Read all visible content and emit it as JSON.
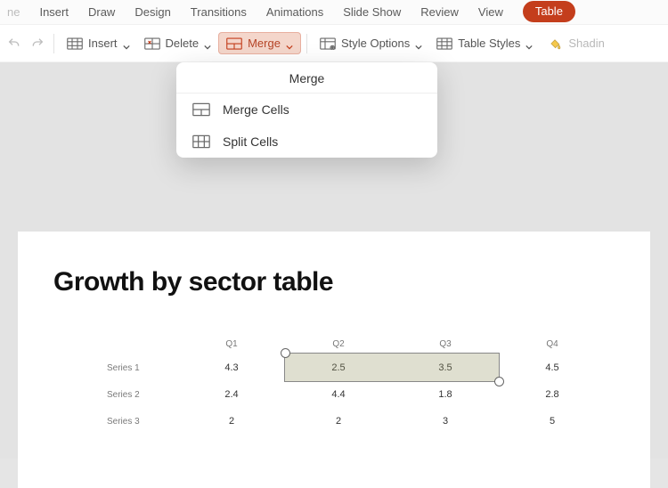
{
  "tabs": {
    "home_cut": "ne",
    "insert": "Insert",
    "draw": "Draw",
    "design": "Design",
    "transitions": "Transitions",
    "animations": "Animations",
    "slideshow": "Slide Show",
    "review": "Review",
    "view": "View",
    "table": "Table",
    "shading_cut": "Shadin"
  },
  "ribbon": {
    "insert": "Insert",
    "delete": "Delete",
    "merge": "Merge",
    "style_options": "Style Options",
    "table_styles": "Table Styles"
  },
  "merge_menu": {
    "title": "Merge",
    "merge_cells": "Merge Cells",
    "split_cells": "Split Cells"
  },
  "slide": {
    "title": "Growth by sector table"
  },
  "chart_data": {
    "type": "table",
    "title": "Growth by sector table",
    "columns": [
      "Q1",
      "Q2",
      "Q3",
      "Q4"
    ],
    "series": [
      {
        "name": "Series 1",
        "values": [
          4.3,
          2.5,
          3.5,
          4.5
        ],
        "color": "#f5c400"
      },
      {
        "name": "Series 2",
        "values": [
          2.4,
          4.4,
          1.8,
          2.8
        ],
        "color": "#6da93c"
      },
      {
        "name": "Series 3",
        "values": [
          2,
          2,
          3,
          5
        ],
        "color": "#2d8a99"
      }
    ],
    "selection": {
      "row": 0,
      "col_start": 1,
      "col_end": 2,
      "note": "cells Q2–Q3 of Series 1 selected"
    }
  }
}
